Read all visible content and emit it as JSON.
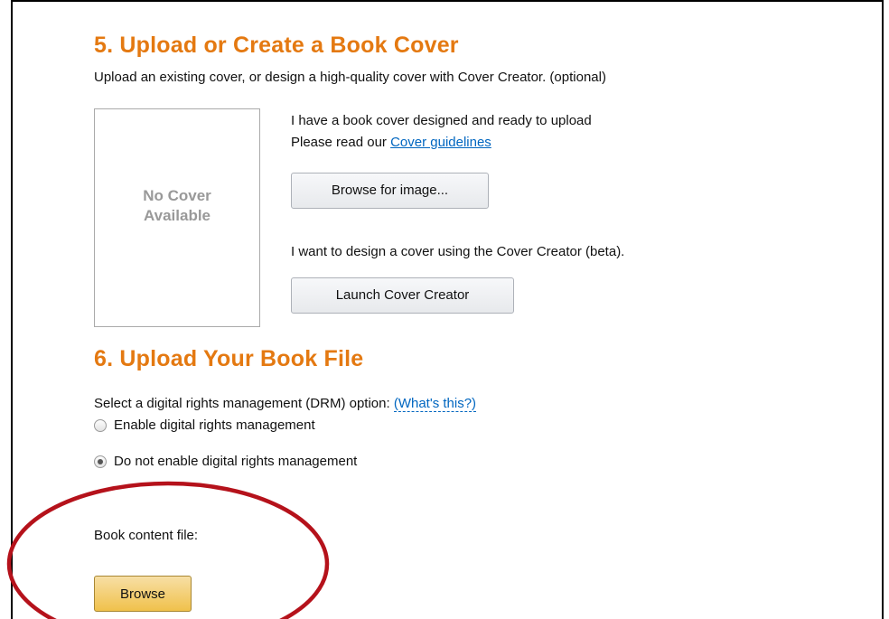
{
  "section5": {
    "title": "5. Upload or Create a Book Cover",
    "subtitle": "Upload an existing cover, or design a high-quality cover with Cover Creator. (optional)",
    "placeholder_line1": "No Cover",
    "placeholder_line2": "Available",
    "have_cover_text": "I have a book cover designed and ready to upload",
    "read_prefix": "Please read our ",
    "guidelines_link": "Cover guidelines",
    "browse_image_button": "Browse for image...",
    "design_text": "I want to design a cover using the Cover Creator (beta).",
    "launch_button": "Launch Cover Creator"
  },
  "section6": {
    "title": "6. Upload Your Book File",
    "drm_prompt": "Select a digital rights management (DRM) option: ",
    "drm_help_link": "(What's this?)",
    "drm_options": [
      {
        "label": "Enable digital rights management",
        "selected": false
      },
      {
        "label": "Do not enable digital rights management",
        "selected": true
      }
    ],
    "content_file_label": "Book content file:",
    "browse_button": "Browse"
  },
  "annotation": {
    "color": "#b5121b"
  }
}
